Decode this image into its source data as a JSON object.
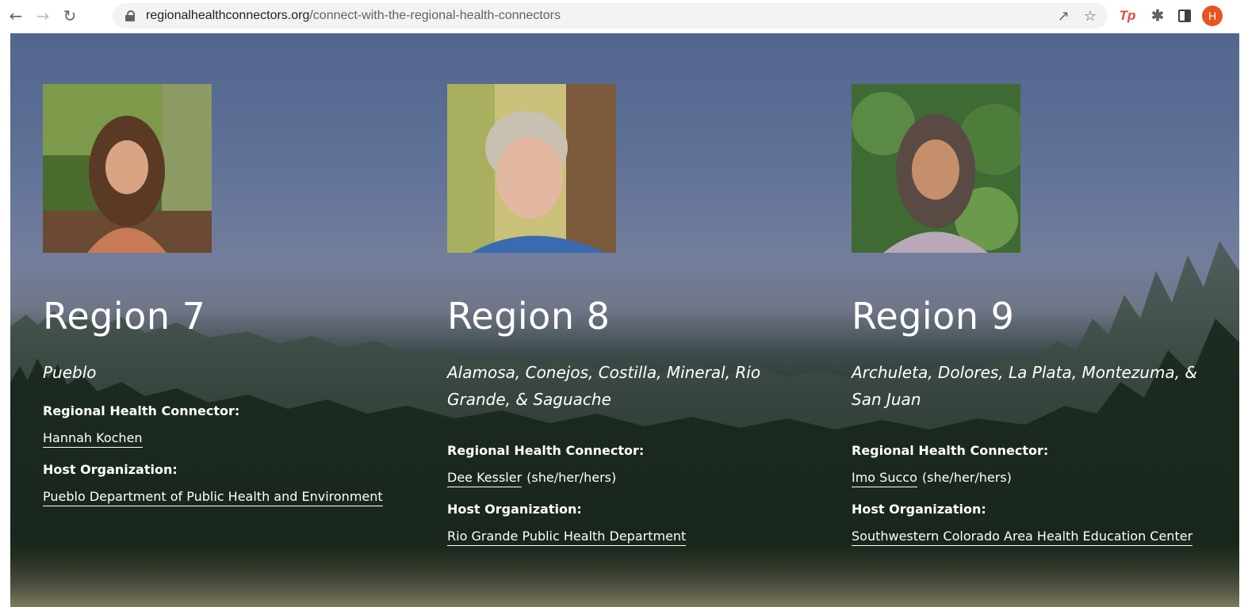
{
  "browser": {
    "url_domain": "regionalhealthconnectors.org",
    "url_path": "/connect-with-the-regional-health-connectors",
    "extension_tp_label": "Tp",
    "profile_initial": "H",
    "accent_colors": {
      "tp_extension": "#e8453c",
      "profile_avatar": "#e8541e"
    }
  },
  "regions": [
    {
      "title": "Region 7",
      "counties": "Pueblo",
      "connector_label": "Regional Health Connector:",
      "connector_name": "Hannah Kochen",
      "pronouns": "",
      "host_label": "Host Organization:",
      "host_org": "Pueblo Department of Public Health and Environment"
    },
    {
      "title": "Region 8",
      "counties": "Alamosa, Conejos, Costilla, Mineral, Rio Grande, & Saguache",
      "connector_label": "Regional Health Connector:",
      "connector_name": "Dee Kessler",
      "pronouns": "(she/her/hers)",
      "host_label": "Host Organization:",
      "host_org": "Rio Grande Public Health Department"
    },
    {
      "title": "Region 9",
      "counties": "Archuleta, Dolores, La Plata, Montezuma, & San Juan",
      "connector_label": "Regional Health Connector:",
      "connector_name": "Imo Succo",
      "pronouns": "(she/her/hers)",
      "host_label": "Host Organization:",
      "host_org": "Southwestern Colorado Area Health Education Center"
    }
  ]
}
